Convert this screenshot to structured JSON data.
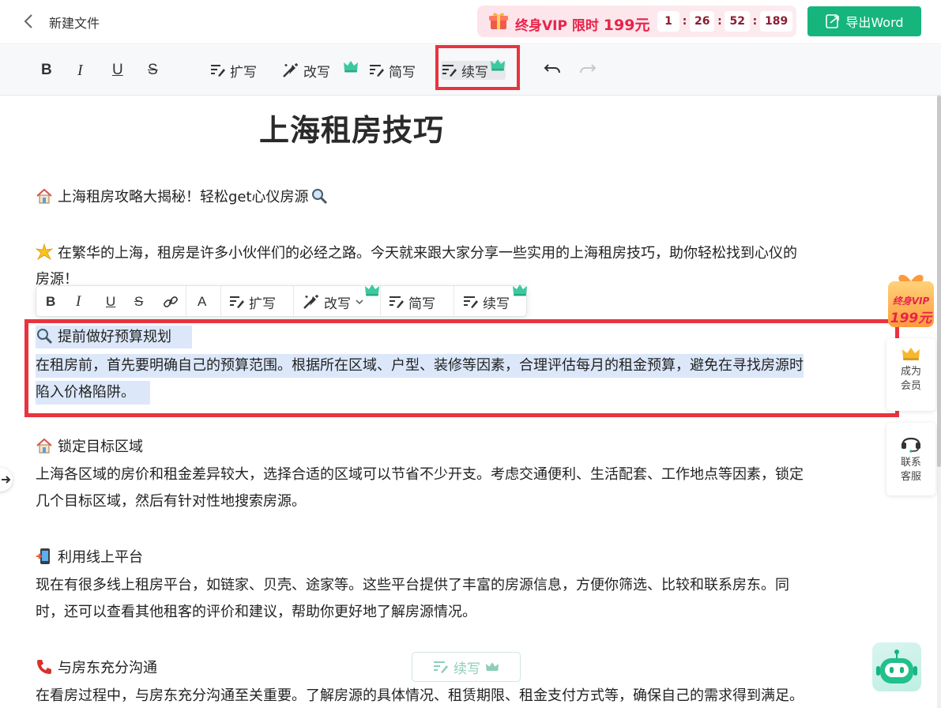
{
  "header": {
    "title": "新建文件",
    "vip": {
      "label": "终身VIP",
      "limited": "限时",
      "price": "199元"
    },
    "timer": [
      "1",
      "26",
      "52",
      "189"
    ],
    "export_label": "导出Word"
  },
  "toolbar": {
    "expand": "扩写",
    "rewrite": "改写",
    "simplify": "简写",
    "continue": "续写"
  },
  "document": {
    "title": "上海租房技巧",
    "intro": "上海租房攻略大揭秘！轻松get心仪房源",
    "para1_line1": "在繁华的上海，租房是许多小伙伴们的必经之路。今天就来跟大家分享一些实用的上海租房技巧，助你轻松找到心仪的",
    "para1_line2": "房源！",
    "section1": {
      "heading": "提前做好预算规划",
      "line1": "在租房前，首先要明确自己的预算范围。根据所在区域、户型、装修等因素，合理评估每月的租金预算，避免在寻找房源时",
      "line2": "陷入价格陷阱。"
    },
    "section2": {
      "heading": "锁定目标区域",
      "line1": "上海各区域的房价和租金差异较大，选择合适的区域可以节省不少开支。考虑交通便利、生活配套、工作地点等因素，锁定",
      "line2": "几个目标区域，然后有针对性地搜索房源。"
    },
    "section3": {
      "heading": "利用线上平台",
      "line1": "现在有很多线上租房平台，如链家、贝壳、途家等。这些平台提供了丰富的房源信息，方便你筛选、比较和联系房东。同",
      "line2": "时，还可以查看其他租客的评价和建议，帮助你更好地了解房源情况。"
    },
    "section4": {
      "heading": "与房东充分沟通",
      "line1": "在看房过程中，与房东充分沟通至关重要。了解房源的具体情况、租赁期限、租金支付方式等，确保自己的需求得到满足。"
    }
  },
  "float_toolbar": {
    "expand": "扩写",
    "rewrite": "改写",
    "simplify": "简写",
    "continue": "续写"
  },
  "side_panel": {
    "promo_label": "终身VIP",
    "promo_price": "199元",
    "member_line1": "成为",
    "member_line2": "会员",
    "service_line1": "联系",
    "service_line2": "客服"
  },
  "bottom_button": "续写",
  "colors": {
    "brand_green": "#16b57e",
    "vip_red": "#e8234a",
    "highlight_red": "#e8343f",
    "selection_blue": "#dce8fa"
  }
}
